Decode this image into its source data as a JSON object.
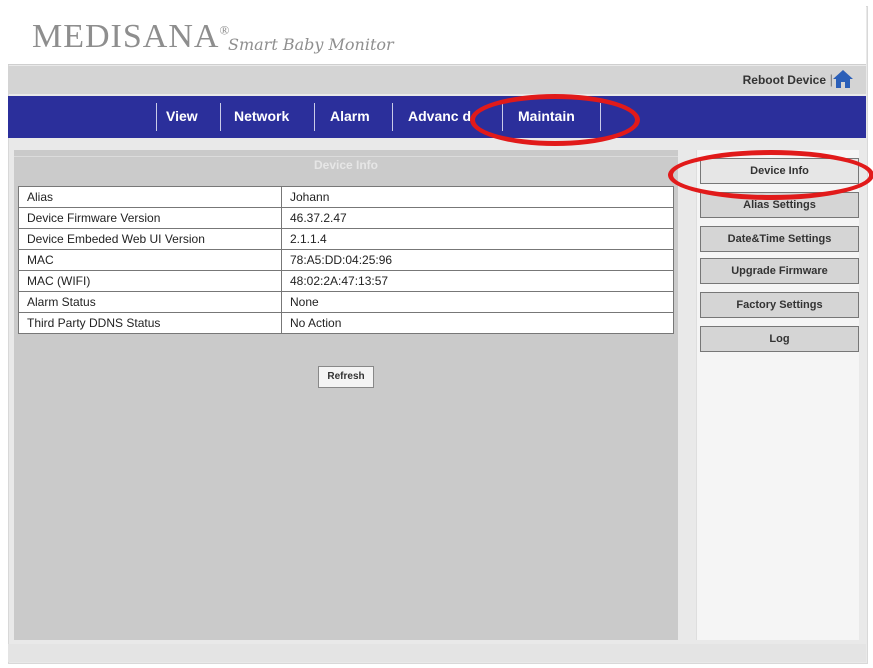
{
  "brand": {
    "name": "MEDISANA",
    "registered": "®",
    "tagline": "Smart Baby Monitor"
  },
  "topbar": {
    "reboot_label": "Reboot Device",
    "separator": "|",
    "home_icon": "home-icon"
  },
  "nav": {
    "items": [
      {
        "label": "View"
      },
      {
        "label": "Network"
      },
      {
        "label": "Alarm"
      },
      {
        "label": "Advanc"
      },
      {
        "label": "d"
      },
      {
        "label": "Maintain"
      }
    ]
  },
  "device_info": {
    "heading": "Device Info",
    "rows": [
      {
        "key": "Alias",
        "value": "Johann"
      },
      {
        "key": "Device Firmware Version",
        "value": "46.37.2.47"
      },
      {
        "key": "Device Embeded Web UI Version",
        "value": "2.1.1.4"
      },
      {
        "key": "MAC",
        "value": "78:A5:DD:04:25:96"
      },
      {
        "key": "MAC (WIFI)",
        "value": "48:02:2A:47:13:57"
      },
      {
        "key": "Alarm Status",
        "value": "None"
      },
      {
        "key": "Third Party DDNS Status",
        "value": "No Action"
      }
    ],
    "refresh_label": "Refresh"
  },
  "sidebar": {
    "buttons": [
      {
        "label": "Device Info"
      },
      {
        "label": "Alias Settings"
      },
      {
        "label": "Date&Time Settings"
      },
      {
        "label": "Upgrade Firmware"
      },
      {
        "label": "Factory Settings"
      },
      {
        "label": "Log"
      }
    ]
  },
  "colors": {
    "nav_bg": "#2b2f9b",
    "highlight": "#e11a1a",
    "panel_bg": "#cacaca"
  }
}
